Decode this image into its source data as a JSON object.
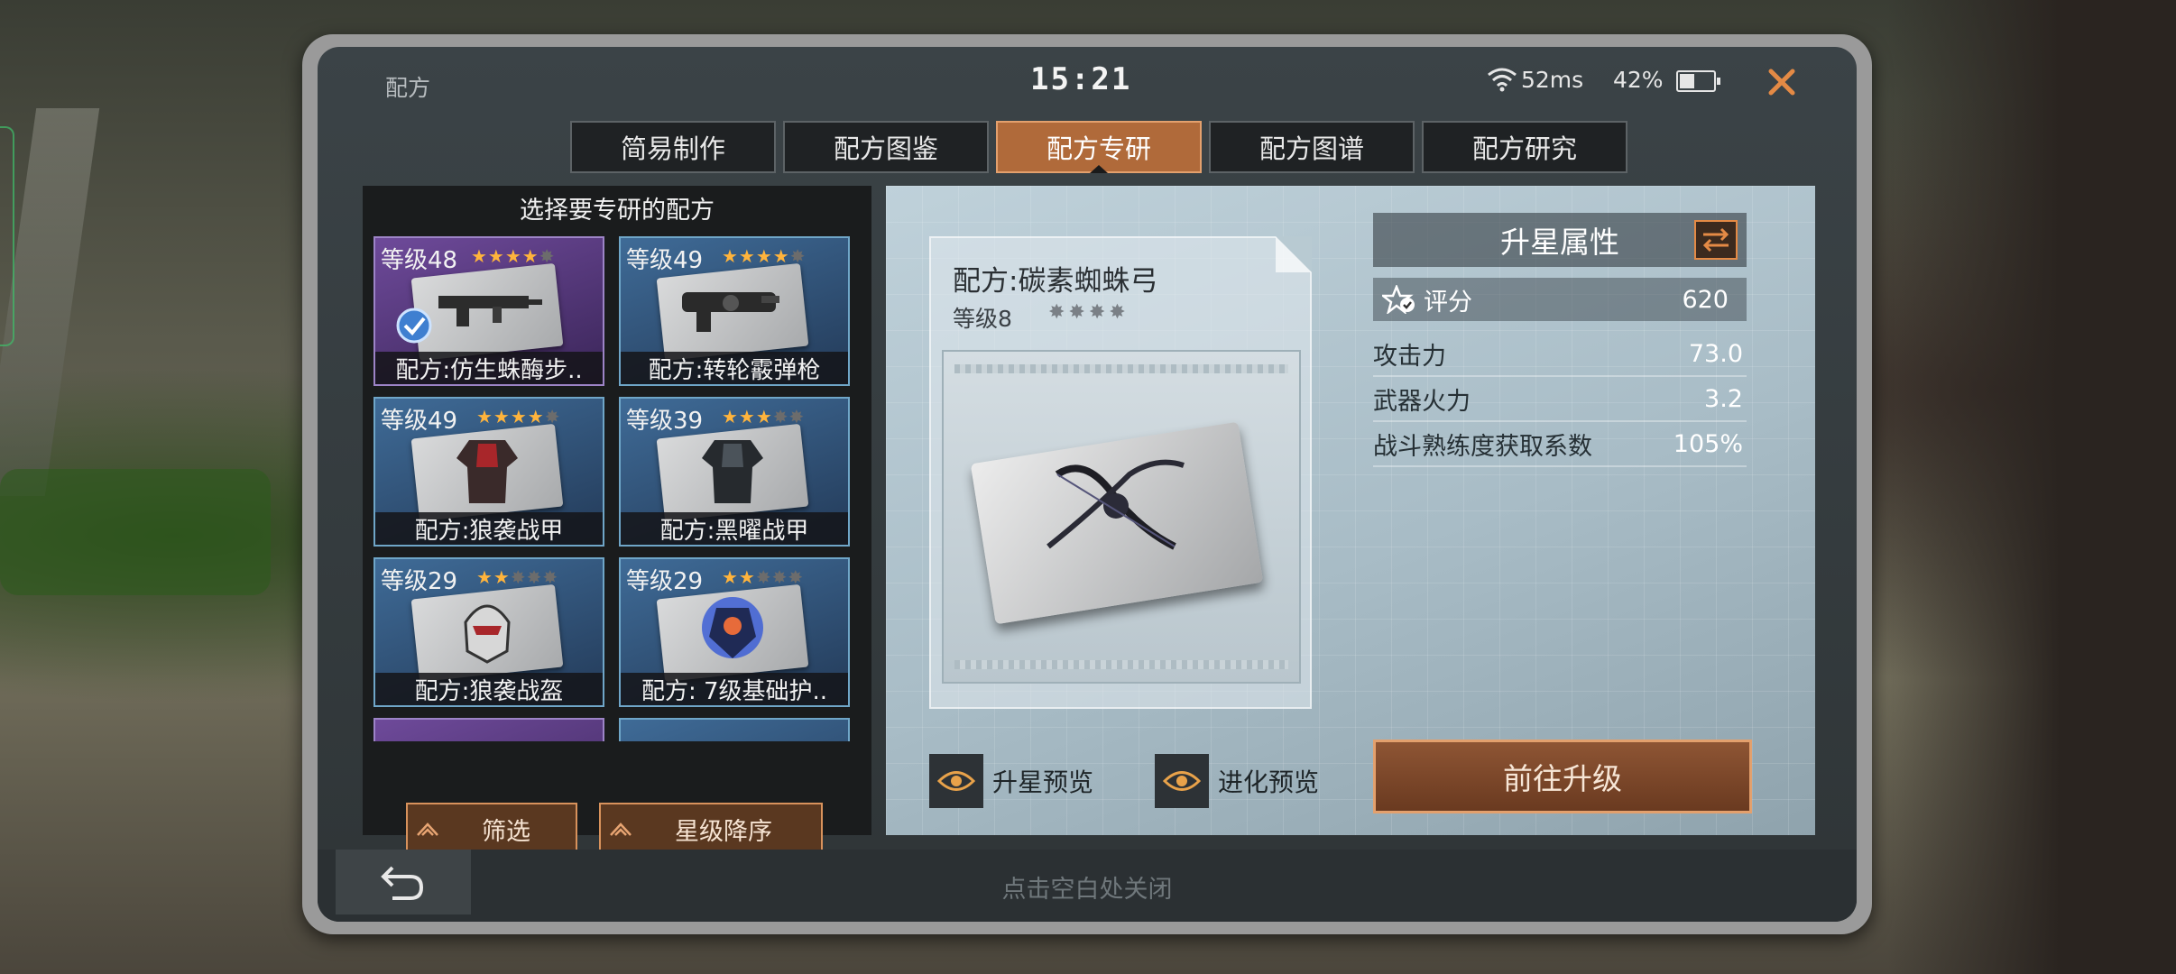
{
  "header": {
    "title": "配方",
    "time": "15:21",
    "ping": "52ms",
    "battery": "42%"
  },
  "tabs": [
    {
      "label": "简易制作",
      "active": false
    },
    {
      "label": "配方图鉴",
      "active": false
    },
    {
      "label": "配方专研",
      "active": true
    },
    {
      "label": "配方图谱",
      "active": false
    },
    {
      "label": "配方研究",
      "active": false
    }
  ],
  "left_panel": {
    "title": "选择要专研的配方",
    "cards": [
      {
        "level": "等级48",
        "stars": 4,
        "max_stars": 5,
        "name": "配方:仿生蛛酶步..",
        "rarity": "purple",
        "item": "rifle"
      },
      {
        "level": "等级49",
        "stars": 4,
        "max_stars": 5,
        "name": "配方:转轮霰弹枪",
        "rarity": "blue",
        "item": "shotgun"
      },
      {
        "level": "等级49",
        "stars": 4,
        "max_stars": 5,
        "name": "配方:狼袭战甲",
        "rarity": "blue",
        "item": "armor-red"
      },
      {
        "level": "等级39",
        "stars": 3,
        "max_stars": 5,
        "name": "配方:黑曜战甲",
        "rarity": "blue",
        "item": "armor-dark"
      },
      {
        "level": "等级29",
        "stars": 2,
        "max_stars": 5,
        "name": "配方:狼袭战盔",
        "rarity": "blue",
        "item": "helmet"
      },
      {
        "level": "等级29",
        "stars": 2,
        "max_stars": 5,
        "name": "配方: 7级基础护..",
        "rarity": "blue",
        "item": "gear"
      }
    ],
    "filter_label": "筛选",
    "sort_label": "星级降序"
  },
  "detail": {
    "recipe_name": "配方:碳素蜘蛛弓",
    "recipe_level": "等级8",
    "recipe_stars": 4,
    "attributes_title": "升星属性",
    "score_label": "评分",
    "score_value": "620",
    "stats": [
      {
        "label": "攻击力",
        "value": "73.0"
      },
      {
        "label": "武器火力",
        "value": "3.2"
      },
      {
        "label": "战斗熟练度获取系数",
        "value": "105%"
      }
    ],
    "star_preview_label": "升星预览",
    "evolve_preview_label": "进化预览",
    "upgrade_label": "前往升级"
  },
  "footer": {
    "close_hint": "点击空白处关闭"
  },
  "colors": {
    "accent": "#b06a3a",
    "accent_border": "#e3a06d",
    "star": "#ffb43c",
    "card_blue": "#3f6b97",
    "card_purple": "#6e4a9a"
  }
}
